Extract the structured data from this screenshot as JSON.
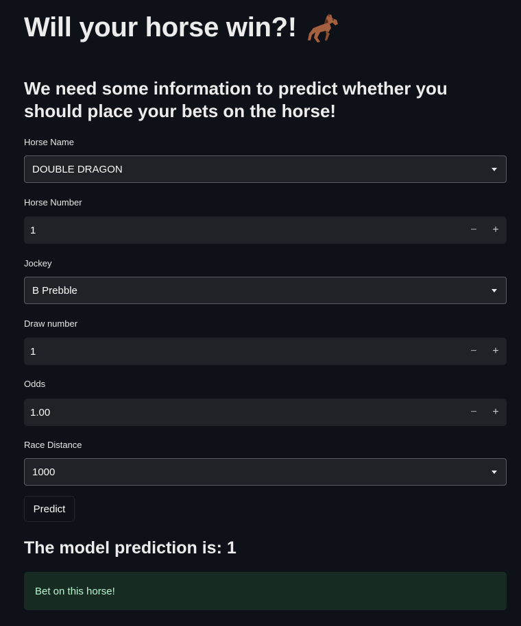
{
  "header": {
    "title": "Will your horse win?!",
    "title_icon": "horse-racing-icon",
    "subtitle": "We need some information to predict whether you should place your bets on the horse!"
  },
  "form": {
    "horse_name": {
      "label": "Horse Name",
      "value": "DOUBLE DRAGON"
    },
    "horse_number": {
      "label": "Horse Number",
      "value": "1"
    },
    "jockey": {
      "label": "Jockey",
      "value": "B Prebble"
    },
    "draw_number": {
      "label": "Draw number",
      "value": "1"
    },
    "odds": {
      "label": "Odds",
      "value": "1.00"
    },
    "race_distance": {
      "label": "Race Distance",
      "value": "1000"
    },
    "stepper_minus": "−",
    "stepper_plus": "+",
    "predict_label": "Predict"
  },
  "result": {
    "heading": "The model prediction is: 1",
    "message": "Bet on this horse!"
  },
  "colors": {
    "background": "#0e1117",
    "input_bg": "#1f2227",
    "success_bg": "#172b23",
    "success_text": "#b7f5cf"
  }
}
